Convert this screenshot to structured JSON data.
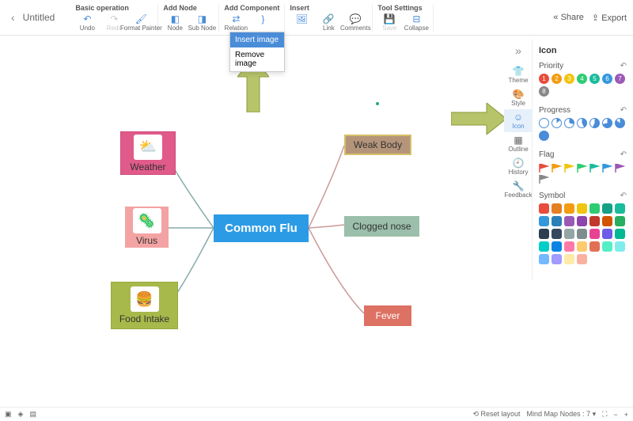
{
  "title": "Untitled",
  "toolbar": {
    "groups": [
      {
        "label": "Basic operation",
        "items": [
          {
            "name": "undo",
            "label": "Undo",
            "icon": "↶",
            "interact": true
          },
          {
            "name": "redo",
            "label": "Redo",
            "icon": "↷",
            "interact": false,
            "disabled": true
          },
          {
            "name": "format-painter",
            "label": "Format Painter",
            "icon": "🖌",
            "interact": true
          }
        ]
      },
      {
        "label": "Add Node",
        "items": [
          {
            "name": "node",
            "label": "Node",
            "icon": "◧",
            "interact": true
          },
          {
            "name": "sub-node",
            "label": "Sub Node",
            "icon": "◨",
            "interact": true
          }
        ]
      },
      {
        "label": "Add Component",
        "items": [
          {
            "name": "relation",
            "label": "Relation",
            "icon": "⇄",
            "interact": true
          },
          {
            "name": "summary",
            "label": "",
            "icon": "}",
            "interact": true
          }
        ]
      },
      {
        "label": "Insert",
        "items": [
          {
            "name": "image",
            "label": "",
            "icon": "🖼",
            "interact": true
          },
          {
            "name": "link",
            "label": "Link",
            "icon": "🔗",
            "interact": true
          },
          {
            "name": "comments",
            "label": "Comments",
            "icon": "💬",
            "interact": true
          }
        ]
      },
      {
        "label": "Tool Settings",
        "items": [
          {
            "name": "save",
            "label": "Save",
            "icon": "💾",
            "interact": false,
            "disabled": true
          },
          {
            "name": "collapse",
            "label": "Collapse",
            "icon": "⊟",
            "interact": true
          }
        ]
      }
    ],
    "share": "Share",
    "export": "Export"
  },
  "dropdown": {
    "insert": "Insert image",
    "remove": "Remove image"
  },
  "sidebar": {
    "items": [
      {
        "name": "theme",
        "label": "Theme",
        "icon": "👕"
      },
      {
        "name": "style",
        "label": "Style",
        "icon": "🎨"
      },
      {
        "name": "icon",
        "label": "Icon",
        "icon": "☺",
        "active": true
      },
      {
        "name": "outline",
        "label": "Outline",
        "icon": "▦"
      },
      {
        "name": "history",
        "label": "History",
        "icon": "🕘"
      },
      {
        "name": "feedback",
        "label": "Feedback",
        "icon": "🔧"
      }
    ]
  },
  "iconPanel": {
    "title": "Icon",
    "undo": "↶",
    "priority": {
      "label": "Priority",
      "colors": [
        "#e74c3c",
        "#f39c12",
        "#f1c40f",
        "#2ecc71",
        "#1abc9c",
        "#3498db",
        "#9b59b6",
        "#888888"
      ]
    },
    "progress": {
      "label": "Progress",
      "steps": 8
    },
    "flag": {
      "label": "Flag",
      "colors": [
        "#e74c3c",
        "#f39c12",
        "#f1c40f",
        "#2ecc71",
        "#1abc9c",
        "#3498db",
        "#9b59b6",
        "#888888"
      ]
    },
    "symbol": {
      "label": "Symbol",
      "colors": [
        "#e74c3c",
        "#e67e22",
        "#f39c12",
        "#f1c40f",
        "#2ecc71",
        "#16a085",
        "#1abc9c",
        "#3498db",
        "#2980b9",
        "#9b59b6",
        "#8e44ad",
        "#c0392b",
        "#d35400",
        "#27ae60",
        "#2c3e50",
        "#34495e",
        "#95a5a6",
        "#7f8c8d",
        "#e84393",
        "#6c5ce7",
        "#00b894",
        "#00cec9",
        "#0984e3",
        "#fd79a8",
        "#fdcb6e",
        "#e17055",
        "#55efc4",
        "#81ecec",
        "#74b9ff",
        "#a29bfe",
        "#ffeaa7",
        "#fab1a0"
      ]
    }
  },
  "nodes": {
    "central": "Common Flu",
    "weather": "Weather",
    "virus": "Virus",
    "food": "Food Intake",
    "weak": "Weak Body",
    "clogged": "Clogged nose",
    "fever": "Fever"
  },
  "status": {
    "reset": "Reset layout",
    "nodes_label": "Mind Map Nodes :",
    "nodes_count": "7"
  }
}
